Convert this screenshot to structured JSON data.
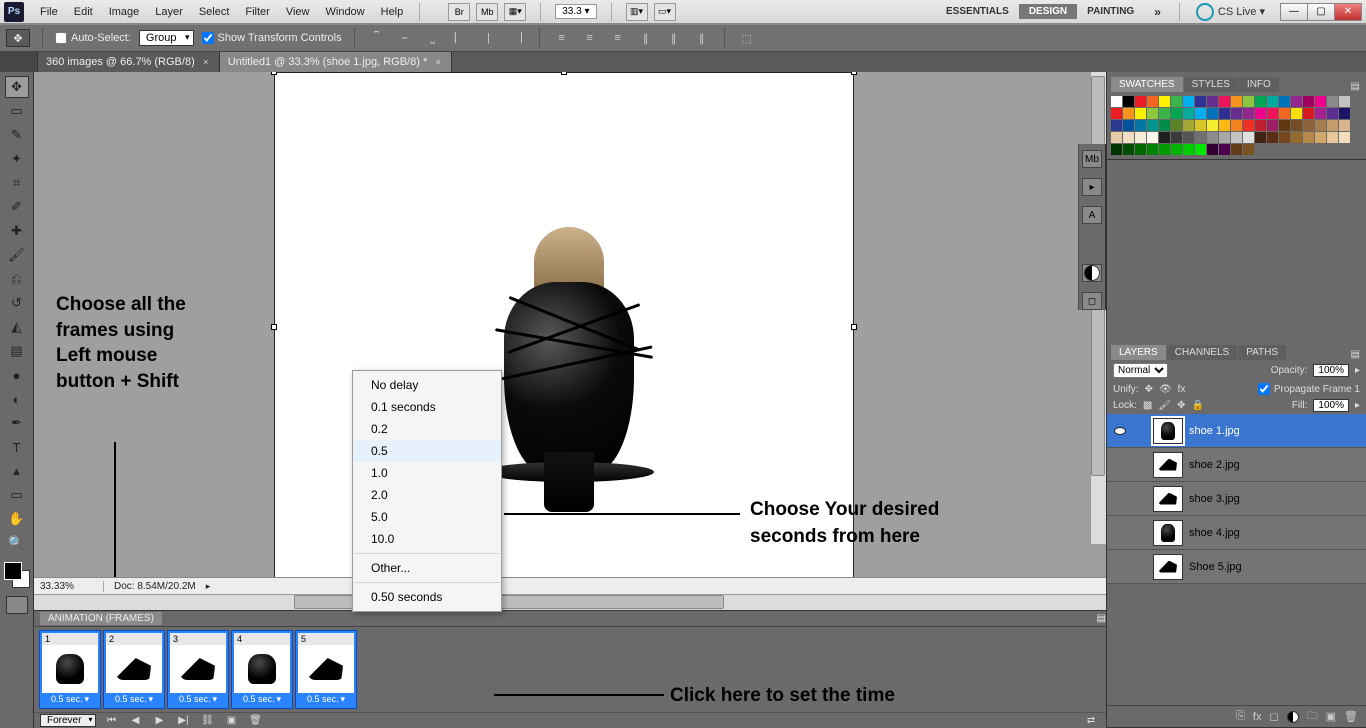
{
  "menu": {
    "items": [
      "File",
      "Edit",
      "Image",
      "Layer",
      "Select",
      "Filter",
      "View",
      "Window",
      "Help"
    ],
    "zoom_value": "33.3",
    "workspaces": {
      "essentials": "ESSENTIALS",
      "design": "DESIGN",
      "painting": "PAINTING"
    },
    "cs_live": "CS Live"
  },
  "options": {
    "auto_select_label": "Auto-Select:",
    "auto_select_value": "Group",
    "show_transform_label": "Show Transform Controls"
  },
  "doc_tabs": {
    "tab1": "360 images @ 66.7% (RGB/8)",
    "tab2": "Untitled1 @ 33.3% (shoe 1.jpg, RGB/8) *"
  },
  "context_menu": {
    "no_delay": "No delay",
    "d01": "0.1 seconds",
    "d02": "0.2",
    "d05": "0.5",
    "d10": "1.0",
    "d20": "2.0",
    "d50": "5.0",
    "d100": "10.0",
    "other": "Other...",
    "current": "0.50 seconds"
  },
  "annotations": {
    "select_all": "Choose all the\nframes using\nLeft mouse\nbutton + Shift",
    "desired_sec1": "Choose Your desired",
    "desired_sec2": "seconds from here",
    "click_set1": "Click here to set the time"
  },
  "status": {
    "zoom": "33.33%",
    "doc_size": "Doc: 8.54M/20.2M"
  },
  "animation": {
    "title": "ANIMATION (FRAMES)",
    "frames": [
      {
        "num": "1",
        "delay": "0.5 sec."
      },
      {
        "num": "2",
        "delay": "0.5 sec."
      },
      {
        "num": "3",
        "delay": "0.5 sec."
      },
      {
        "num": "4",
        "delay": "0.5 sec."
      },
      {
        "num": "5",
        "delay": "0.5 sec."
      }
    ],
    "loop": "Forever"
  },
  "swatches_tab": "SWATCHES",
  "styles_tab": "STYLES",
  "info_tab": "INFO",
  "swatch_colors": [
    "#ffffff",
    "#000000",
    "#ec1c24",
    "#f26522",
    "#fff200",
    "#39b54a",
    "#00aeef",
    "#2e3192",
    "#662d91",
    "#ed145b",
    "#f7941d",
    "#8dc63f",
    "#00a651",
    "#00a99d",
    "#0072bc",
    "#92278f",
    "#9e005d",
    "#ed008c",
    "#898989",
    "#c2c2c2",
    "#ed1c24",
    "#f7941d",
    "#fff200",
    "#8dc63f",
    "#39b54a",
    "#00a651",
    "#00a99d",
    "#00aeef",
    "#0072bc",
    "#2e3192",
    "#662d91",
    "#92278f",
    "#ec008c",
    "#ed145b",
    "#f26522",
    "#ffde00",
    "#d71920",
    "#a3238e",
    "#5c2d91",
    "#1b1464",
    "#2b388f",
    "#00529b",
    "#0076a3",
    "#009390",
    "#008c48",
    "#598527",
    "#a2a736",
    "#d7c627",
    "#f5ee30",
    "#fdb913",
    "#f58220",
    "#ee3124",
    "#be1e2d",
    "#9e1f63",
    "#603913",
    "#754c24",
    "#8c6239",
    "#a67c52",
    "#c69c6d",
    "#d9b48f",
    "#e6cba9",
    "#f0ddc3",
    "#f7ecd9",
    "#fdf6ec",
    "#221f1f",
    "#3b3b3b",
    "#555555",
    "#707070",
    "#8c8c8c",
    "#a8a8a8",
    "#c4c4c4",
    "#e0e0e0",
    "#412312",
    "#5b2f16",
    "#77471f",
    "#946b2d",
    "#b6894a",
    "#d4a86a",
    "#e8c89a",
    "#f2ddbd",
    "#003300",
    "#004d00",
    "#006600",
    "#008000",
    "#009900",
    "#00b300",
    "#00cc00",
    "#00e600",
    "#330033",
    "#4d004d",
    "#613d1a",
    "#7a5323"
  ],
  "layers_panel": {
    "tabs": {
      "layers": "LAYERS",
      "channels": "CHANNELS",
      "paths": "PATHS"
    },
    "blend_mode": "Normal",
    "opacity_label": "Opacity:",
    "opacity_value": "100%",
    "unify_label": "Unify:",
    "propagate_label": "Propagate Frame 1",
    "lock_label": "Lock:",
    "fill_label": "Fill:",
    "fill_value": "100%",
    "layers": [
      {
        "name": "shoe 1.jpg"
      },
      {
        "name": "shoe 2.jpg"
      },
      {
        "name": "shoe 3.jpg"
      },
      {
        "name": "shoe 4.jpg"
      },
      {
        "name": "Shoe 5.jpg"
      }
    ]
  }
}
